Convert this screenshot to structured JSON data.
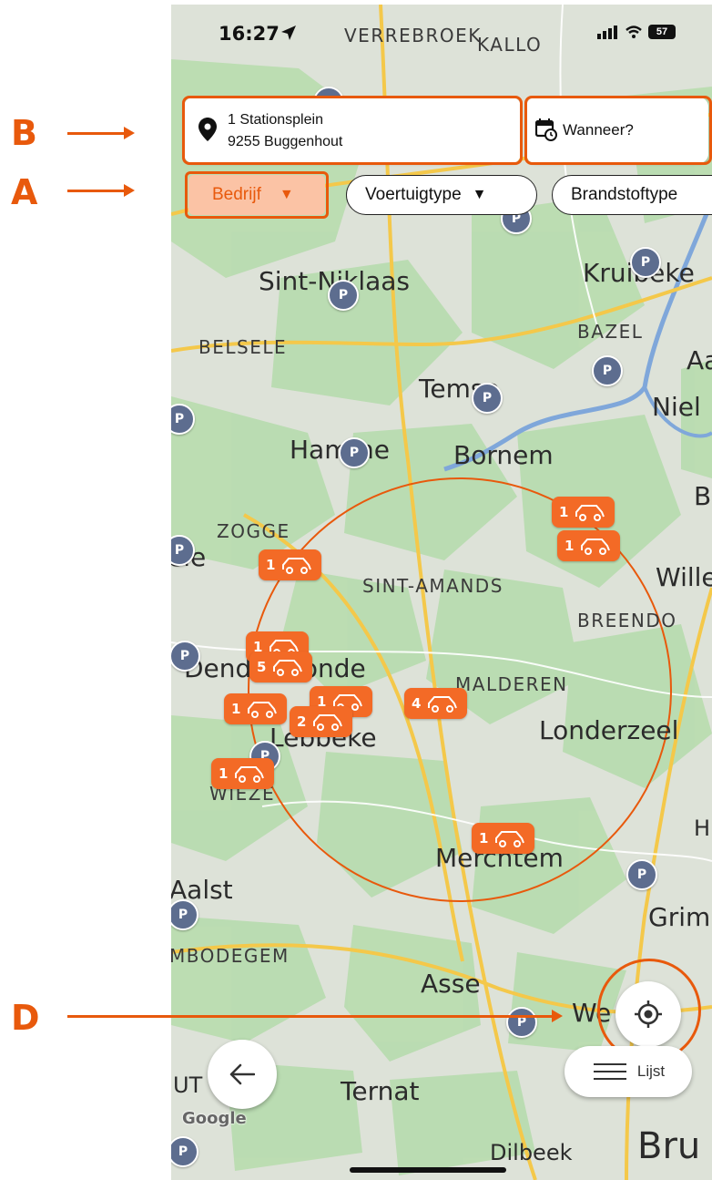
{
  "annotations": {
    "a": "A",
    "b": "B",
    "d": "D"
  },
  "status_bar": {
    "time": "16:27",
    "battery": "57"
  },
  "search": {
    "address_line1": "1 Stationsplein",
    "address_line2": "9255 Buggenhout",
    "when_label": "Wanneer?"
  },
  "filters": {
    "company": "Bedrijf",
    "vehicle_type": "Voertuigtype",
    "fuel_type": "Brandstoftype"
  },
  "map": {
    "places": {
      "verrebroek": "VERREBROEK",
      "kallo": "KALLO",
      "sint_niklaas": "Sint-Niklaas",
      "kruibeke": "Kruibeke",
      "bazel": "BAZEL",
      "belsele": "BELSELE",
      "temse": "Temse",
      "niel": "Niel",
      "hamme": "Hamme",
      "bornem": "Bornem",
      "zogge": "ZOGGE",
      "ele": "ele",
      "sint_amands": "SINT-AMANDS",
      "willebroek": "Wille",
      "breendonk": "BREENDO",
      "dendermonde": "Dendermonde",
      "malderen": "MALDEREN",
      "lebbeke": "Lebbeke",
      "londerzeel": "Londerzeel",
      "wieze": "WIEZE",
      "merchtem": "Merchtem",
      "aalst": "Aalst",
      "grimbergen": "Grim",
      "mbodegem": "MBODEGEM",
      "asse": "Asse",
      "wemmel": "We",
      "ternat": "Ternat",
      "dilbeek": "Dilbeek",
      "brussel": "Bru",
      "aa": "Aa",
      "b": "B",
      "h": "H",
      "ut": "UT"
    },
    "parking_label": "P",
    "car_counts": [
      "1",
      "1",
      "1",
      "1",
      "5",
      "1",
      "1",
      "2",
      "4",
      "1",
      "1"
    ]
  },
  "buttons": {
    "list_label": "Lijst"
  },
  "attribution": "Google",
  "colors": {
    "accent": "#e8590c",
    "marker": "#f36a26",
    "chip_active_bg": "#fbc3a5",
    "parking": "#5d6d8f"
  },
  "icons": [
    "location-pin-icon",
    "calendar-clock-icon",
    "car-icon",
    "parking-icon",
    "locate-me-icon",
    "back-arrow-icon",
    "list-icon",
    "navigation-arrow-icon",
    "wifi-icon",
    "signal-icon",
    "battery-icon"
  ]
}
